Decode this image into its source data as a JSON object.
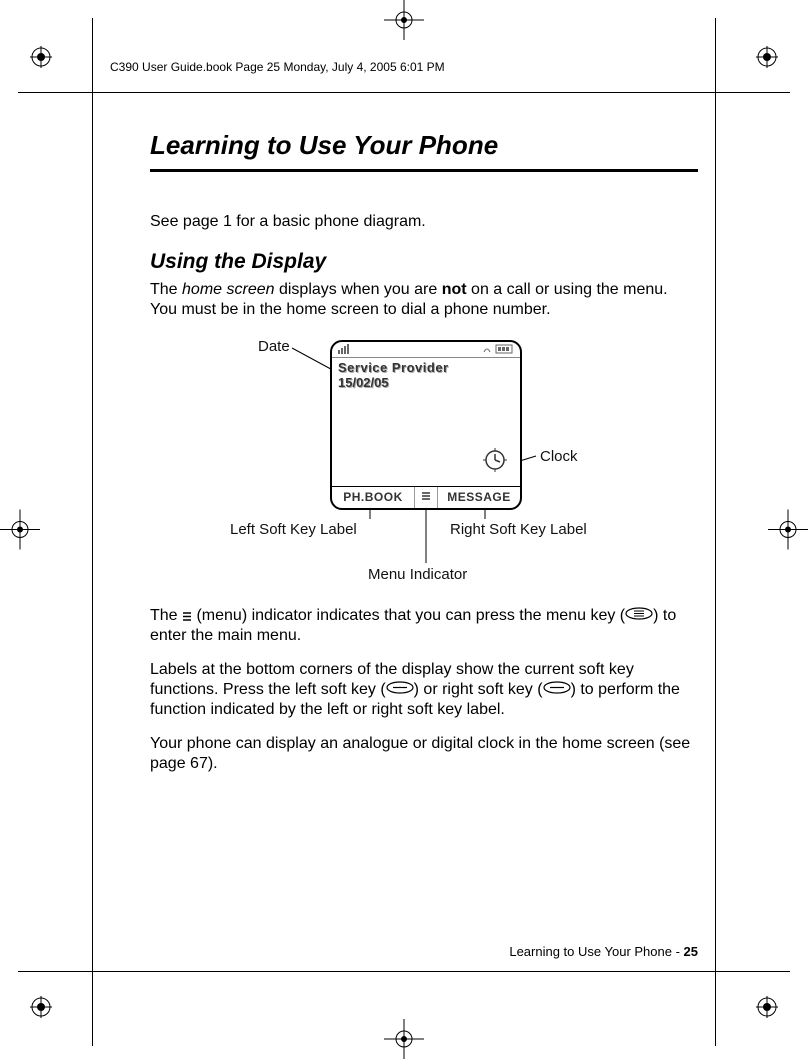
{
  "header": "C390 User Guide.book  Page 25  Monday, July 4, 2005  6:01 PM",
  "title": "Learning to Use Your Phone",
  "intro": "See page 1 for a basic phone diagram.",
  "section_heading": "Using the Display",
  "para1_a": "The ",
  "para1_b": "home screen",
  "para1_c": " displays when you are ",
  "para1_d": "not",
  "para1_e": " on a call or using the menu. You must be in the home screen to dial a phone number.",
  "diagram": {
    "provider": "Service Provider",
    "date": "15/02/05",
    "left_soft": "PH.BOOK",
    "right_soft": "MESSAGE",
    "callouts": {
      "date": "Date",
      "clock": "Clock",
      "left": "Left Soft Key Label",
      "right": "Right Soft Key Label",
      "menu": "Menu Indicator"
    }
  },
  "para2_a": "The ",
  "para2_b": " (menu) indicator indicates that you can press the menu key (",
  "para2_c": ") to enter the main menu.",
  "para3_a": "Labels at the bottom corners of the display show the current soft key functions. Press the left soft key (",
  "para3_b": ") or right soft key (",
  "para3_c": ") to perform the function indicated by the left or right soft key label.",
  "para4": "Your phone can display an analogue or digital clock in the home screen (see page 67).",
  "footer_a": "Learning to Use Your Phone - ",
  "footer_b": "25"
}
